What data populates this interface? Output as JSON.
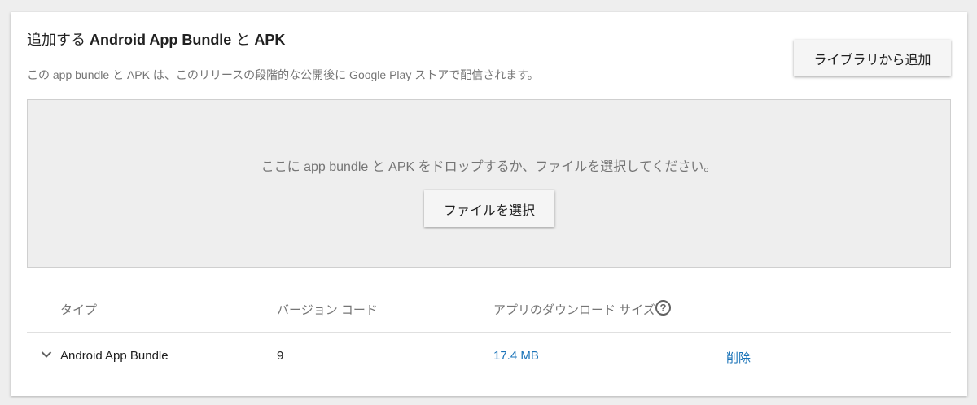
{
  "section": {
    "title_prefix": "追加する ",
    "title_bold1": "Android App Bundle",
    "title_mid": " と ",
    "title_bold2": "APK",
    "subtitle": "この app bundle と APK は、このリリースの段階的な公開後に Google Play ストアで配信されます。",
    "add_from_library_label": "ライブラリから追加"
  },
  "dropzone": {
    "instruction": "ここに app bundle と APK をドロップするか、ファイルを選択してください。",
    "select_file_label": "ファイルを選択"
  },
  "table": {
    "headers": {
      "type": "タイプ",
      "version_code": "バージョン コード",
      "download_size": "アプリのダウンロード サイズ",
      "help_glyph": "?"
    },
    "rows": [
      {
        "type": "Android App Bundle",
        "version_code": "9",
        "download_size": "17.4 MB",
        "action": "削除"
      }
    ]
  },
  "icons": {
    "help": "help-circle-icon",
    "expand": "chevron-down-icon"
  },
  "colors": {
    "link": "#1a73b8",
    "background": "#eeeeee",
    "card": "#ffffff",
    "muted_text": "#757575"
  }
}
